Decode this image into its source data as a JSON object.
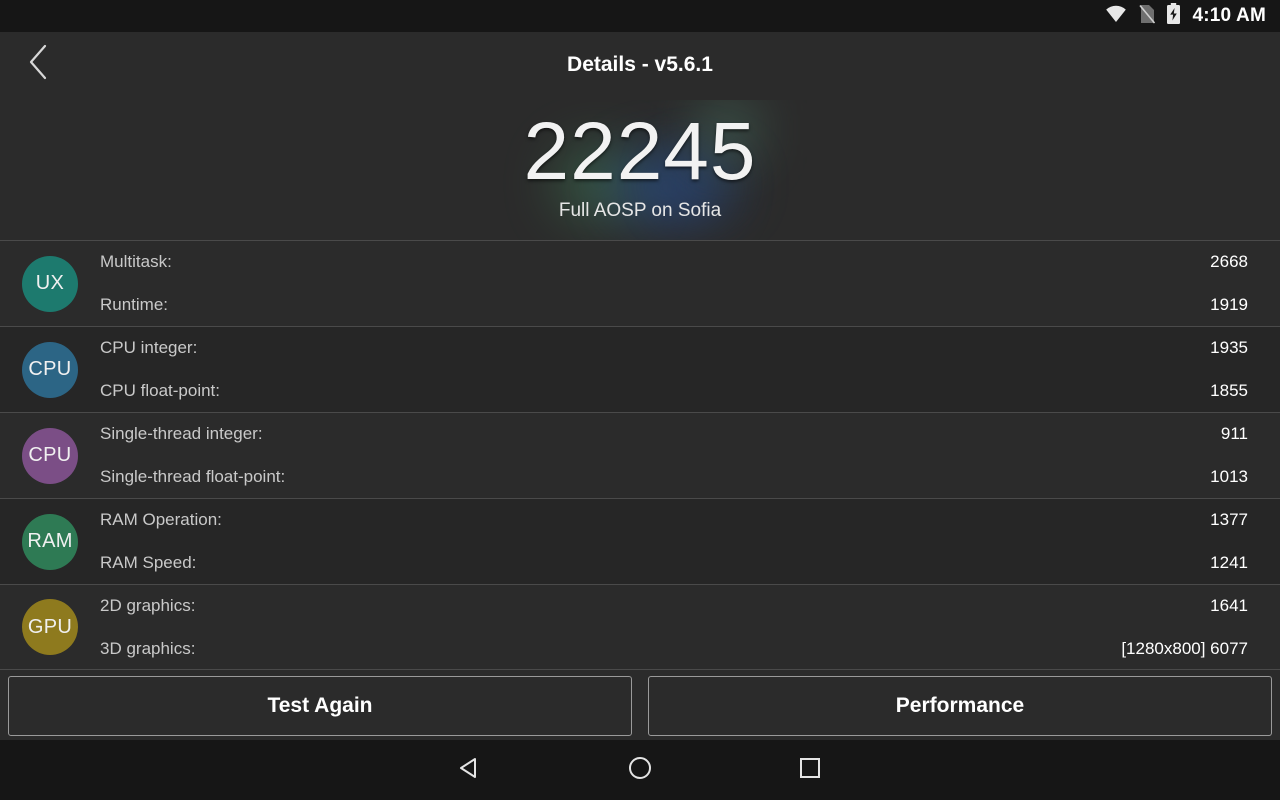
{
  "statusbar": {
    "time": "4:10 AM",
    "icons": [
      "wifi-icon",
      "no-sim-icon",
      "battery-charging-icon"
    ]
  },
  "header": {
    "back_icon": "chevron-left-icon",
    "title": "Details - v5.6.1"
  },
  "hero": {
    "score": "22245",
    "device": "Full AOSP on Sofia"
  },
  "rows": [
    {
      "badge": "UX",
      "badge_color": "#1d7a6e",
      "metrics": [
        {
          "label": "Multitask:",
          "value": "2668"
        },
        {
          "label": "Runtime:",
          "value": "1919"
        }
      ]
    },
    {
      "badge": "CPU",
      "badge_color": "#2c6585",
      "metrics": [
        {
          "label": "CPU integer:",
          "value": "1935"
        },
        {
          "label": "CPU float-point:",
          "value": "1855"
        }
      ]
    },
    {
      "badge": "CPU",
      "badge_color": "#7b4e86",
      "metrics": [
        {
          "label": "Single-thread integer:",
          "value": "911"
        },
        {
          "label": "Single-thread float-point:",
          "value": "1013"
        }
      ]
    },
    {
      "badge": "RAM",
      "badge_color": "#2e7a54",
      "metrics": [
        {
          "label": "RAM Operation:",
          "value": "1377"
        },
        {
          "label": "RAM Speed:",
          "value": "1241"
        }
      ]
    },
    {
      "badge": "GPU",
      "badge_color": "#8e7a1e",
      "metrics": [
        {
          "label": "2D graphics:",
          "value": "1641"
        },
        {
          "label": "3D graphics:",
          "value": "[1280x800] 6077"
        }
      ]
    }
  ],
  "buttons": {
    "test_again": "Test Again",
    "performance": "Performance"
  },
  "navbar": {
    "back_icon": "nav-back-triangle-icon",
    "home_icon": "nav-home-circle-icon",
    "recents_icon": "nav-recents-square-icon"
  }
}
